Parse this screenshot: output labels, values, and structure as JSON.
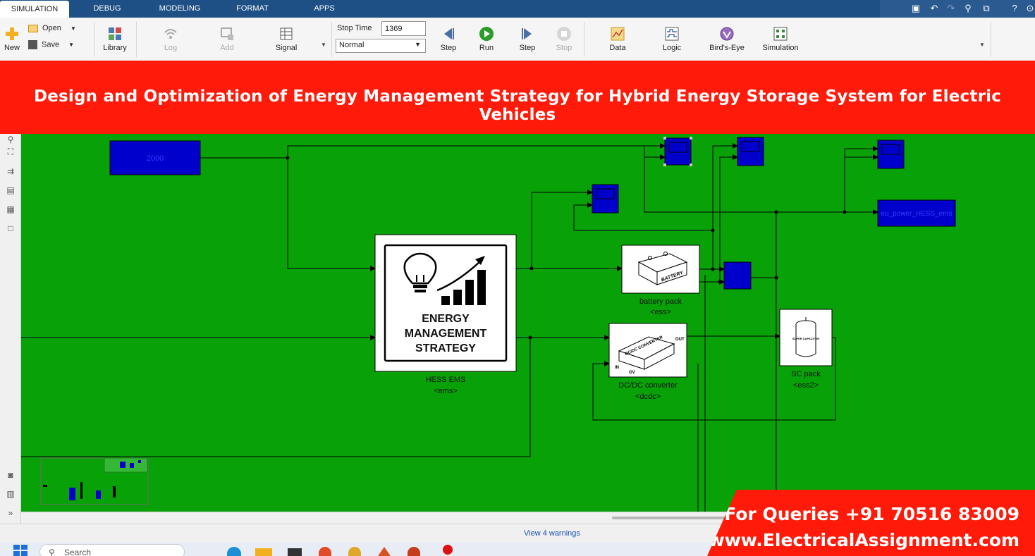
{
  "tabs": [
    {
      "label": "SIMULATION",
      "active": true
    },
    {
      "label": "DEBUG",
      "active": false
    },
    {
      "label": "MODELING",
      "active": false
    },
    {
      "label": "FORMAT",
      "active": false
    },
    {
      "label": "APPS",
      "active": false
    }
  ],
  "toolstrip": {
    "new_label": "New",
    "open_label": "Open",
    "save_label": "Save",
    "library_label": "Library",
    "log_label": "Log",
    "add_label": "Add",
    "signal_table_label": "Signal",
    "stop_time_label": "Stop Time",
    "stop_time_value": "1369",
    "sim_mode": "Normal",
    "step_back_label": "Step",
    "run_label": "Run",
    "step_forward_label": "Step",
    "stop_label": "Stop",
    "data_inspector_label": "Data",
    "logic_analyzer_label": "Logic",
    "birds_eye_label": "Bird's-Eye",
    "sim_manager_label": "Simulation"
  },
  "banner": {
    "title": "Design and Optimization of Energy Management Strategy for Hybrid Energy Storage System for Electric Vehicles"
  },
  "diagram": {
    "constant_value": "2000",
    "ems_icon_lines": [
      "ENERGY",
      "MANAGEMENT",
      "STRATEGY"
    ],
    "ems_name": "HESS EMS",
    "ems_ref": "<ems>",
    "battery_icon_text": "BATTERY",
    "battery_name": "battery pack",
    "battery_ref": "<ess>",
    "dcdc_icon_text": "DC/DC CONVERTER",
    "dcdc_out": "OUT",
    "dcdc_in": "IN",
    "dcdc_gv": "GV",
    "dcdc_name": "DC/DC converter",
    "dcdc_ref": "<dcdc>",
    "sc_icon_text": "SUPER CAPACITOR",
    "sc_name": "SC pack",
    "sc_ref": "<ess2>",
    "workspace_block": "eu_power_HESS_ems"
  },
  "status": {
    "warnings_link": "View 4 warnings"
  },
  "taskbar": {
    "search_placeholder": "Search"
  },
  "contact": {
    "phone": "For Queries +91 70516 83009",
    "website": "www.ElectricalAssignment.com"
  },
  "colors": {
    "canvas_bg": "#08a208",
    "block_blue": "#0000cc",
    "banner_red": "#ff1a0a",
    "tab_bar": "#1e4f85"
  }
}
